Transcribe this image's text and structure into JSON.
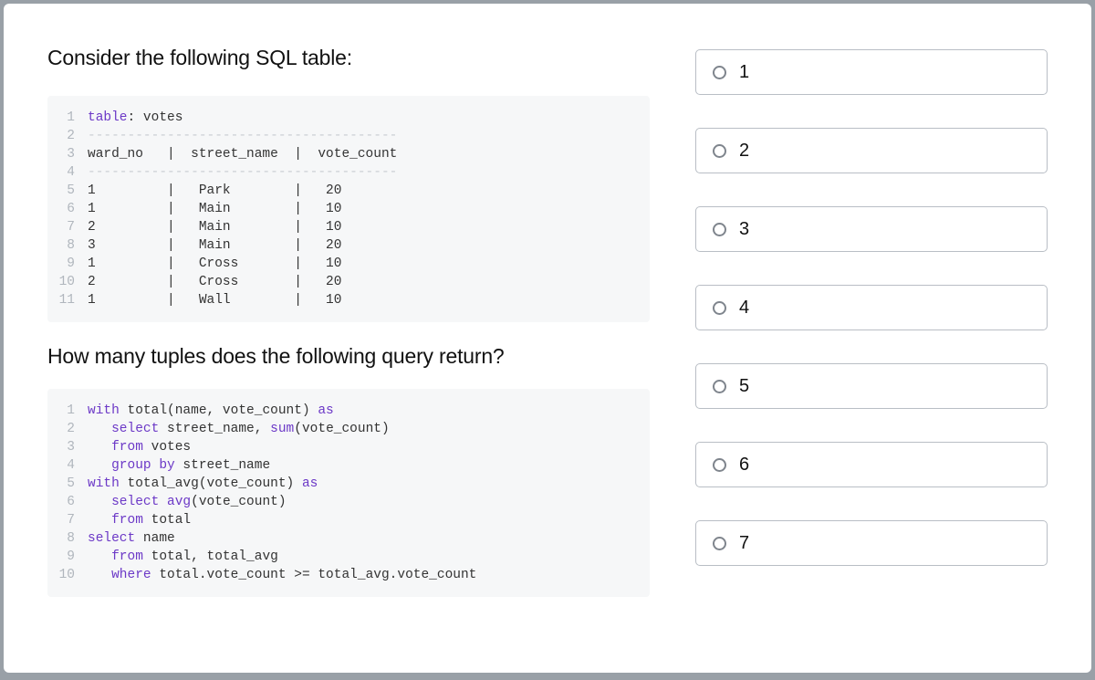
{
  "question": {
    "prompt1": "Consider the following SQL table:",
    "prompt2": "How many tuples does the following query return?"
  },
  "table_block": {
    "lines": [
      {
        "n": "1",
        "segments": [
          {
            "t": "table",
            "c": "kw"
          },
          {
            "t": ": votes",
            "c": ""
          }
        ]
      },
      {
        "n": "2",
        "segments": [
          {
            "t": "---------------------------------------",
            "c": "dash"
          }
        ]
      },
      {
        "n": "3",
        "segments": [
          {
            "t": "ward_no   |  street_name  |  vote_count",
            "c": ""
          }
        ]
      },
      {
        "n": "4",
        "segments": [
          {
            "t": "---------------------------------------",
            "c": "dash"
          }
        ]
      },
      {
        "n": "5",
        "segments": [
          {
            "t": "1         |   Park        |   20",
            "c": ""
          }
        ]
      },
      {
        "n": "6",
        "segments": [
          {
            "t": "1         |   Main        |   10",
            "c": ""
          }
        ]
      },
      {
        "n": "7",
        "segments": [
          {
            "t": "2         |   Main        |   10",
            "c": ""
          }
        ]
      },
      {
        "n": "8",
        "segments": [
          {
            "t": "3         |   Main        |   20",
            "c": ""
          }
        ]
      },
      {
        "n": "9",
        "segments": [
          {
            "t": "1         |   Cross       |   10",
            "c": ""
          }
        ]
      },
      {
        "n": "10",
        "segments": [
          {
            "t": "2         |   Cross       |   20",
            "c": ""
          }
        ]
      },
      {
        "n": "11",
        "segments": [
          {
            "t": "1         |   Wall        |   10",
            "c": ""
          }
        ]
      }
    ]
  },
  "query_block": {
    "lines": [
      {
        "n": "1",
        "segments": [
          {
            "t": "with",
            "c": "kw"
          },
          {
            "t": " total(name, vote_count) ",
            "c": ""
          },
          {
            "t": "as",
            "c": "kw"
          }
        ]
      },
      {
        "n": "2",
        "segments": [
          {
            "t": "   ",
            "c": ""
          },
          {
            "t": "select",
            "c": "kw"
          },
          {
            "t": " street_name, ",
            "c": ""
          },
          {
            "t": "sum",
            "c": "kw"
          },
          {
            "t": "(vote_count)",
            "c": ""
          }
        ]
      },
      {
        "n": "3",
        "segments": [
          {
            "t": "   ",
            "c": ""
          },
          {
            "t": "from",
            "c": "kw"
          },
          {
            "t": " votes",
            "c": ""
          }
        ]
      },
      {
        "n": "4",
        "segments": [
          {
            "t": "   ",
            "c": ""
          },
          {
            "t": "group by",
            "c": "kw"
          },
          {
            "t": " street_name",
            "c": ""
          }
        ]
      },
      {
        "n": "5",
        "segments": [
          {
            "t": "with",
            "c": "kw"
          },
          {
            "t": " total_avg(vote_count) ",
            "c": ""
          },
          {
            "t": "as",
            "c": "kw"
          }
        ]
      },
      {
        "n": "6",
        "segments": [
          {
            "t": "   ",
            "c": ""
          },
          {
            "t": "select",
            "c": "kw"
          },
          {
            "t": " ",
            "c": ""
          },
          {
            "t": "avg",
            "c": "kw"
          },
          {
            "t": "(vote_count)",
            "c": ""
          }
        ]
      },
      {
        "n": "7",
        "segments": [
          {
            "t": "   ",
            "c": ""
          },
          {
            "t": "from",
            "c": "kw"
          },
          {
            "t": " total",
            "c": ""
          }
        ]
      },
      {
        "n": "8",
        "segments": [
          {
            "t": "select",
            "c": "kw"
          },
          {
            "t": " name",
            "c": ""
          }
        ]
      },
      {
        "n": "9",
        "segments": [
          {
            "t": "   ",
            "c": ""
          },
          {
            "t": "from",
            "c": "kw"
          },
          {
            "t": " total, total_avg",
            "c": ""
          }
        ]
      },
      {
        "n": "10",
        "segments": [
          {
            "t": "   ",
            "c": ""
          },
          {
            "t": "where",
            "c": "kw"
          },
          {
            "t": " total.vote_count >= total_avg.vote_count",
            "c": ""
          }
        ]
      }
    ]
  },
  "options": [
    {
      "label": "1"
    },
    {
      "label": "2"
    },
    {
      "label": "3"
    },
    {
      "label": "4"
    },
    {
      "label": "5"
    },
    {
      "label": "6"
    },
    {
      "label": "7"
    }
  ]
}
